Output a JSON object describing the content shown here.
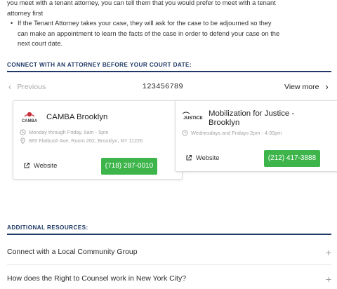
{
  "intro": {
    "line1": "you meet with a tenant attorney, you can tell them that you would prefer to meet with a tenant attorney first",
    "bullet_dot": "•",
    "bullet": "If the Tenant Attorney takes your case, they will ask for the case to be adjourned so they can make an appointment to learn the facts of the case in order to defend your case on the next court date."
  },
  "connect_section": {
    "title": "CONNECT WITH AN ATTORNEY BEFORE YOUR COURT DATE:"
  },
  "pager": {
    "prev_label": "Previous",
    "pages": [
      "1",
      "2",
      "3",
      "4",
      "5",
      "6",
      "7",
      "8",
      "9"
    ],
    "next_label": "View more"
  },
  "cards": [
    {
      "name": "CAMBA Brooklyn",
      "logo_text": "CAMBA",
      "hours": "Monday through Friday, 9am - 5pm",
      "address": "885 Flatbush Ave, Room 202, Brooklyn, NY 11226",
      "website_label": "Website",
      "phone": "(718) 287-0010"
    },
    {
      "name_line1": "Mobilization for Justice -",
      "name_line2": "Brooklyn",
      "logo_text": "JUSTICE",
      "hours": "Wednesdays and Fridays 2pm - 4:30pm",
      "website_label": "Website",
      "phone": "(212) 417-3888"
    }
  ],
  "resources_section": {
    "title": "ADDITIONAL RESOURCES:",
    "items": [
      {
        "label": "Connect with a Local Community Group",
        "icon": "+"
      },
      {
        "label": "How does the Right to Counsel work in New York City?",
        "icon": "+"
      }
    ]
  },
  "colors": {
    "heading_navy": "#1f3a66",
    "phone_green": "#3db54a",
    "camba_red": "#c8323a"
  }
}
